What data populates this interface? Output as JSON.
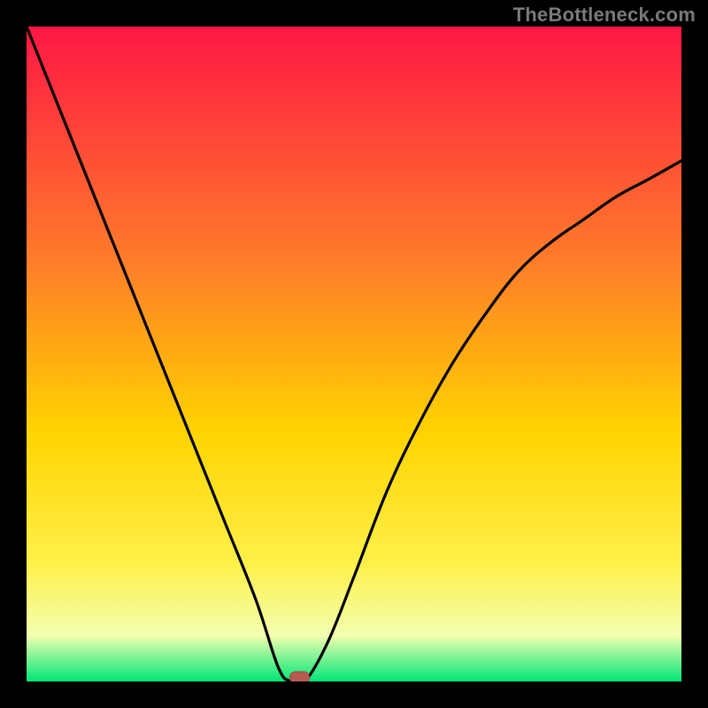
{
  "watermark": "TheBottleneck.com",
  "colors": {
    "frame": "#000000",
    "curve": "#000000",
    "marker_fill": "#b85a52",
    "marker_stroke": "#9c4a44",
    "grad_top": "#ff1744",
    "grad_mid1": "#ff7a2a",
    "grad_mid2": "#ffd400",
    "grad_mid3": "#fff04a",
    "grad_mid4": "#f3ffb0",
    "grad_bottom": "#00e676"
  },
  "chart_data": {
    "type": "line",
    "title": "",
    "xlabel": "",
    "ylabel": "",
    "xlim": [
      0,
      1
    ],
    "ylim": [
      0,
      1
    ],
    "series": [
      {
        "name": "bottleneck-curve",
        "x": [
          0.0,
          0.05,
          0.1,
          0.15,
          0.2,
          0.25,
          0.3,
          0.35,
          0.385,
          0.405,
          0.425,
          0.46,
          0.5,
          0.55,
          0.6,
          0.65,
          0.7,
          0.75,
          0.8,
          0.85,
          0.9,
          0.95,
          1.0
        ],
        "values": [
          1.0,
          0.875,
          0.75,
          0.625,
          0.5,
          0.375,
          0.25,
          0.125,
          0.02,
          0.0,
          0.0,
          0.06,
          0.16,
          0.29,
          0.395,
          0.485,
          0.56,
          0.625,
          0.67,
          0.705,
          0.74,
          0.767,
          0.795
        ]
      }
    ],
    "marker": {
      "x": 0.417,
      "y": 0.0
    }
  }
}
